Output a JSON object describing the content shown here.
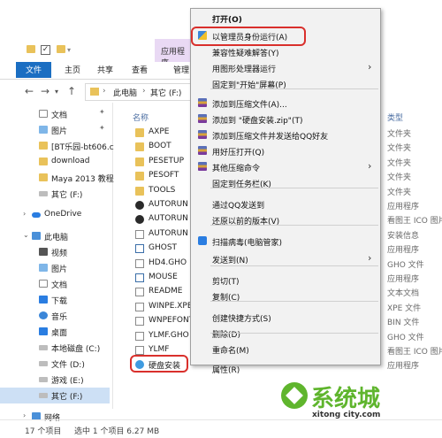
{
  "explorer": {
    "title_tab": "应用程序",
    "ribbon_tabs": {
      "file": "文件",
      "home": "主页",
      "share": "共享",
      "view": "查看",
      "manage": "管理"
    },
    "breadcrumb": {
      "pc": "此电脑",
      "drive": "其它 (F:)"
    },
    "sidebar": [
      {
        "label": "文档",
        "icon": "document-icon",
        "pinned": true
      },
      {
        "label": "图片",
        "icon": "pictures-icon",
        "pinned": true
      },
      {
        "label": "[BT乐园-bt606.c",
        "icon": "folder-icon",
        "pinned": false
      },
      {
        "label": "download",
        "icon": "folder-icon",
        "pinned": false
      },
      {
        "label": "Maya 2013 教程",
        "icon": "folder-icon",
        "pinned": false
      },
      {
        "label": "其它 (F:)",
        "icon": "drive-icon",
        "pinned": false
      },
      {
        "label": "OneDrive",
        "icon": "onedrive-icon",
        "pinned": false
      },
      {
        "label": "此电脑",
        "icon": "pc-icon",
        "pinned": false
      },
      {
        "label": "视频",
        "icon": "videos-icon",
        "pinned": false
      },
      {
        "label": "图片",
        "icon": "pictures-icon",
        "pinned": false
      },
      {
        "label": "文档",
        "icon": "document-icon",
        "pinned": false
      },
      {
        "label": "下载",
        "icon": "download-icon",
        "pinned": false
      },
      {
        "label": "音乐",
        "icon": "music-icon",
        "pinned": false
      },
      {
        "label": "桌面",
        "icon": "desktop-icon",
        "pinned": false
      },
      {
        "label": "本地磁盘 (C:)",
        "icon": "drive-icon",
        "pinned": false
      },
      {
        "label": "文件 (D:)",
        "icon": "drive-icon",
        "pinned": false
      },
      {
        "label": "游戏 (E:)",
        "icon": "drive-icon",
        "pinned": false
      },
      {
        "label": "其它 (F:)",
        "icon": "drive-icon",
        "pinned": false
      },
      {
        "label": "网络",
        "icon": "network-icon",
        "pinned": false
      }
    ],
    "columns": {
      "name": "名称",
      "type": "类型"
    },
    "files": [
      {
        "name": "AXPE",
        "type": "文件夹",
        "icon": "folder"
      },
      {
        "name": "BOOT",
        "type": "文件夹",
        "icon": "folder"
      },
      {
        "name": "PESETUP",
        "type": "文件夹",
        "icon": "folder"
      },
      {
        "name": "PESOFT",
        "type": "文件夹",
        "icon": "folder"
      },
      {
        "name": "TOOLS",
        "type": "文件夹",
        "icon": "folder"
      },
      {
        "name": "AUTORUN",
        "type": "应用程序",
        "icon": "exe"
      },
      {
        "name": "AUTORUN",
        "type": "看图王 ICO 图片",
        "icon": "exe"
      },
      {
        "name": "AUTORUN",
        "type": "安装信息",
        "icon": "doc"
      },
      {
        "name": "GHOST",
        "type": "应用程序",
        "icon": "ghost"
      },
      {
        "name": "HD4.GHO",
        "type": "GHO 文件",
        "icon": "doc"
      },
      {
        "name": "MOUSE",
        "type": "应用程序",
        "icon": "ghost"
      },
      {
        "name": "README",
        "type": "文本文档",
        "icon": "doc"
      },
      {
        "name": "WINPE.XPE",
        "type": "XPE 文件",
        "icon": "doc"
      },
      {
        "name": "WNPEFONT",
        "type": "BIN 文件",
        "icon": "doc"
      },
      {
        "name": "YLMF.GHO",
        "type": "GHO 文件",
        "icon": "doc"
      },
      {
        "name": "YLMF",
        "type": "看图王 ICO 图片",
        "icon": "doc"
      },
      {
        "name": "硬盘安装",
        "type": "应用程序",
        "icon": "setup"
      }
    ],
    "status": {
      "count": "17 个项目",
      "selected": "选中 1 个项目 6.27 MB"
    }
  },
  "context_menu": {
    "items": [
      {
        "label": "打开(O)",
        "bold": true,
        "icon": "",
        "submenu": false
      },
      {
        "label": "以管理员身份运行(A)",
        "bold": false,
        "icon": "shield",
        "submenu": false
      },
      {
        "label": "兼容性疑难解答(Y)",
        "bold": false,
        "icon": "",
        "submenu": false
      },
      {
        "label": "用图形处理器运行",
        "bold": false,
        "icon": "",
        "submenu": true
      },
      {
        "label": "固定到\"开始\"屏幕(P)",
        "bold": false,
        "icon": "",
        "submenu": false
      },
      {
        "label": "添加到压缩文件(A)...",
        "bold": false,
        "icon": "zip",
        "submenu": false
      },
      {
        "label": "添加到 \"硬盘安装.zip\"(T)",
        "bold": false,
        "icon": "zip",
        "submenu": false
      },
      {
        "label": "添加到压缩文件并发送给QQ好友",
        "bold": false,
        "icon": "zip",
        "submenu": false
      },
      {
        "label": "用好压打开(Q)",
        "bold": false,
        "icon": "zip",
        "submenu": false
      },
      {
        "label": "其他压缩命令",
        "bold": false,
        "icon": "zip",
        "submenu": true
      },
      {
        "label": "固定到任务栏(K)",
        "bold": false,
        "icon": "",
        "submenu": false
      },
      {
        "label": "通过QQ发送到",
        "bold": false,
        "icon": "",
        "submenu": false
      },
      {
        "label": "还原以前的版本(V)",
        "bold": false,
        "icon": "",
        "submenu": false
      },
      {
        "label": "扫描病毒(电脑管家)",
        "bold": false,
        "icon": "qqmgr",
        "submenu": false
      },
      {
        "label": "发送到(N)",
        "bold": false,
        "icon": "",
        "submenu": true
      },
      {
        "label": "剪切(T)",
        "bold": false,
        "icon": "",
        "submenu": false
      },
      {
        "label": "复制(C)",
        "bold": false,
        "icon": "",
        "submenu": false
      },
      {
        "label": "创建快捷方式(S)",
        "bold": false,
        "icon": "",
        "submenu": false
      },
      {
        "label": "删除(D)",
        "bold": false,
        "icon": "",
        "submenu": false
      },
      {
        "label": "重命名(M)",
        "bold": false,
        "icon": "",
        "submenu": false
      },
      {
        "label": "属性(R)",
        "bold": false,
        "icon": "",
        "submenu": false
      }
    ]
  },
  "watermark": {
    "title": "系统城",
    "url": "xitong city.com",
    "color": "#5fb52d"
  }
}
